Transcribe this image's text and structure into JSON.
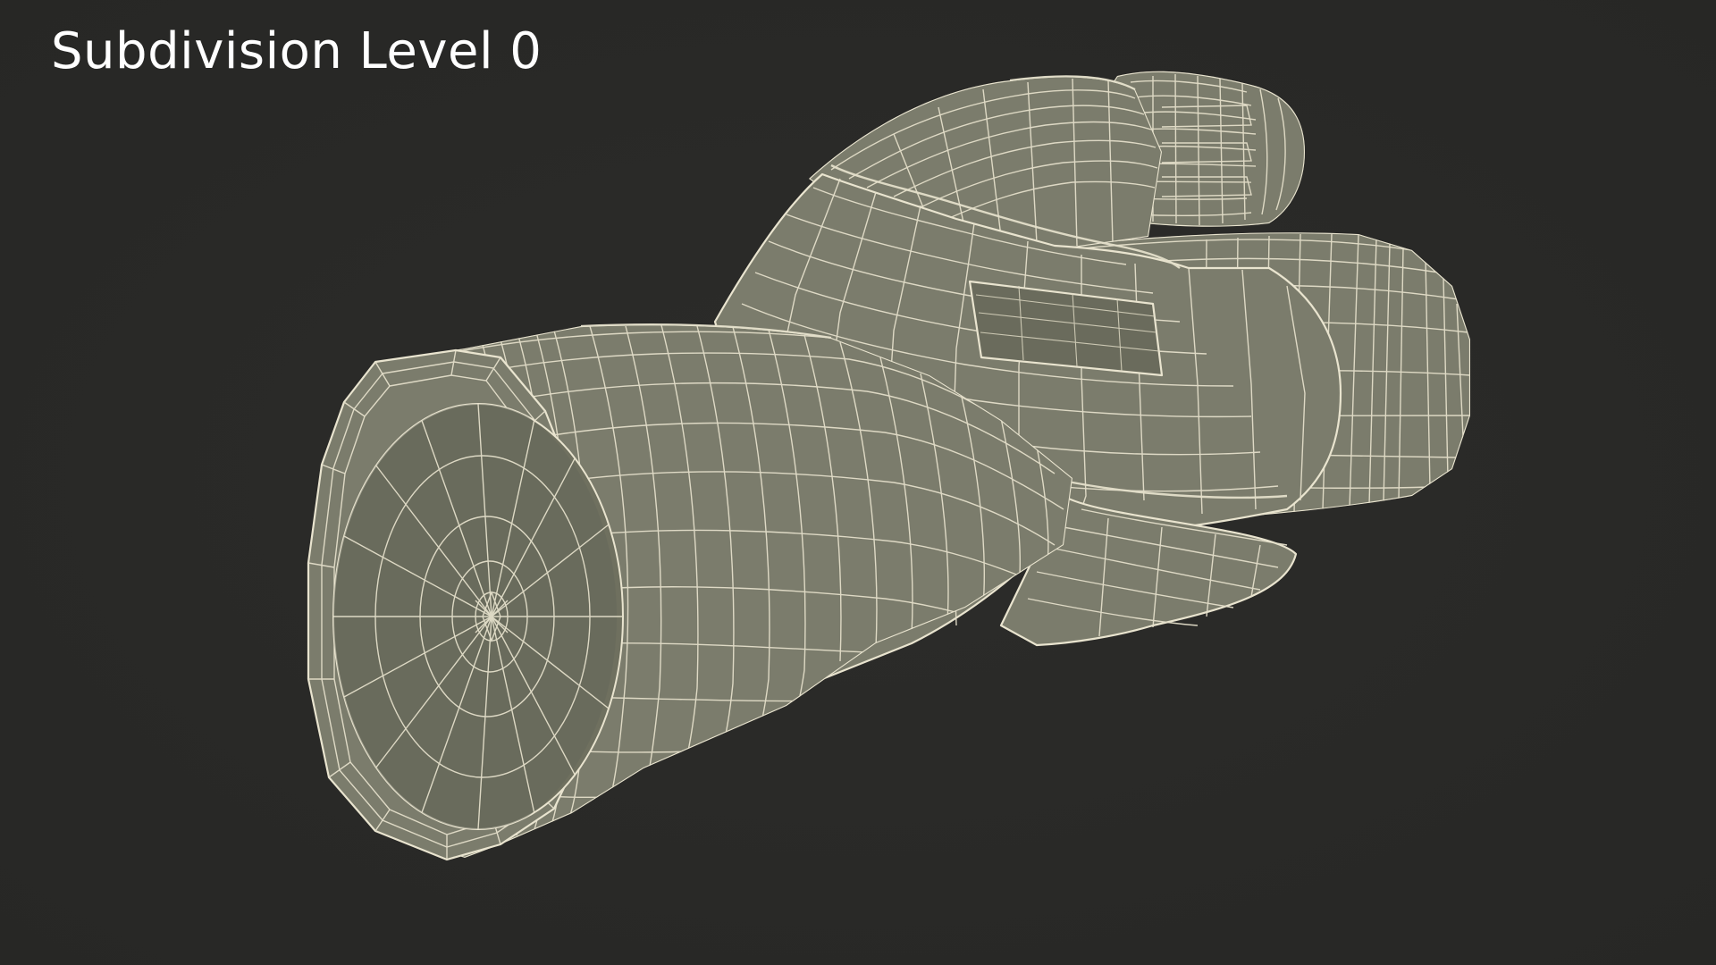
{
  "viewport": {
    "title": "Subdivision Level 0",
    "background_color": "#2a2a28",
    "mesh_color": "#7b7c6c",
    "wire_color": "#e9e4cf"
  },
  "model": {
    "icon": "flashlight-wireframe"
  }
}
